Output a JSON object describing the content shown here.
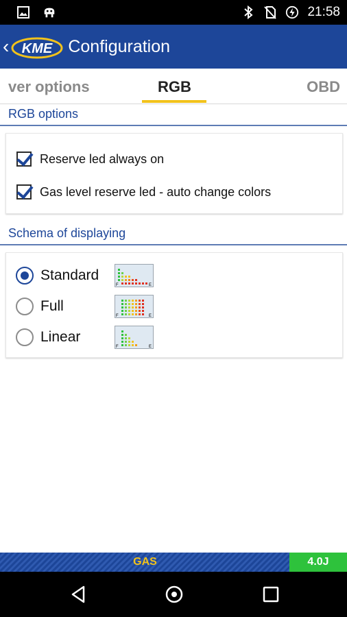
{
  "status_bar": {
    "time": "21:58",
    "left_icons": [
      "image-icon",
      "android-debug-icon"
    ],
    "right_icons": [
      "bluetooth-icon",
      "no-sim-icon",
      "battery-charging-icon"
    ]
  },
  "app_bar": {
    "logo_text": "KME",
    "title": "Configuration",
    "color": "#1d4699"
  },
  "tabs": {
    "left": "ver options",
    "center": "RGB",
    "right": "OBD",
    "indicator_color": "#f2c21b"
  },
  "rgb_section": {
    "title": "RGB options",
    "options": [
      {
        "label": "Reserve led always on",
        "checked": true
      },
      {
        "label": "Gas level reserve led - auto change colors",
        "checked": true
      }
    ]
  },
  "schema_section": {
    "title": "Schema of displaying",
    "options": [
      {
        "label": "Standard",
        "selected": true,
        "icon": "schema-standard-icon"
      },
      {
        "label": "Full",
        "selected": false,
        "icon": "schema-full-icon"
      },
      {
        "label": "Linear",
        "selected": false,
        "icon": "schema-linear-icon"
      }
    ]
  },
  "bottom_bar": {
    "fuel": "GAS",
    "version": "4.0J",
    "fuel_color": "#f2c21b",
    "version_bg": "#2ec23c"
  },
  "nav_bar": {
    "buttons": [
      "back-icon",
      "home-icon",
      "recents-icon"
    ]
  }
}
